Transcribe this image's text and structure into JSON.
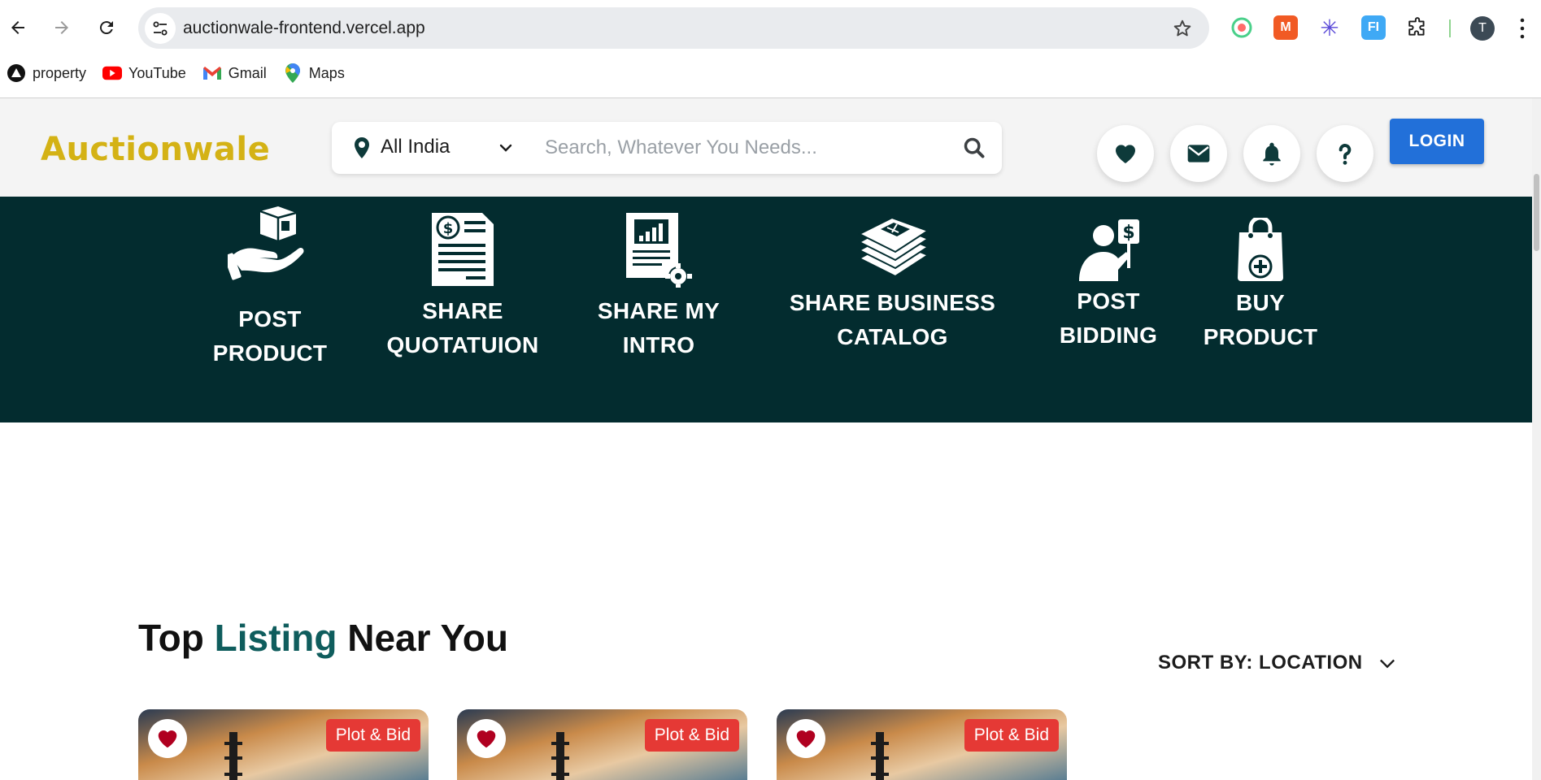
{
  "browser": {
    "url": "auctionwale-frontend.vercel.app",
    "profile_initial": "T",
    "extensions": [
      "circle-ext-icon",
      "m-ext-icon",
      "asterisk-ext-icon",
      "fi-ext-icon",
      "puzzle-icon"
    ],
    "bookmarks": [
      {
        "label": "property",
        "icon": "triangle-icon"
      },
      {
        "label": "YouTube",
        "icon": "youtube-icon"
      },
      {
        "label": "Gmail",
        "icon": "gmail-icon"
      },
      {
        "label": "Maps",
        "icon": "maps-icon"
      }
    ]
  },
  "header": {
    "logo": "Auctionwale",
    "location": "All India",
    "search_placeholder": "Search, Whatever You Needs...",
    "icons": [
      "heart-icon",
      "mail-icon",
      "bell-icon",
      "help-icon"
    ],
    "login_label": "LOGIN",
    "colors": {
      "logo": "#d4b215",
      "band": "#032c2f",
      "login": "#2270d9"
    }
  },
  "actions": [
    {
      "line1": "POST",
      "line2": "PRODUCT",
      "icon": "hand-box-icon"
    },
    {
      "line1": "SHARE",
      "line2": "QUOTATUION",
      "icon": "invoice-icon"
    },
    {
      "line1": "SHARE MY",
      "line2": "INTRO",
      "icon": "report-gear-icon"
    },
    {
      "line1": "SHARE BUSINESS",
      "line2": "CATALOG",
      "icon": "catalog-stack-icon"
    },
    {
      "line1": "POST",
      "line2": "BIDDING",
      "icon": "bidder-icon"
    },
    {
      "line1": "BUY",
      "line2": "PRODUCT",
      "icon": "shopping-bag-icon"
    }
  ],
  "listing": {
    "title_part1": "Top ",
    "title_accent": "Listing",
    "title_part2": " Near You",
    "sort_label": "SORT BY: LOCATION",
    "cards": [
      {
        "badge": "Plot & Bid"
      },
      {
        "badge": "Plot & Bid"
      },
      {
        "badge": "Plot & Bid"
      }
    ]
  }
}
